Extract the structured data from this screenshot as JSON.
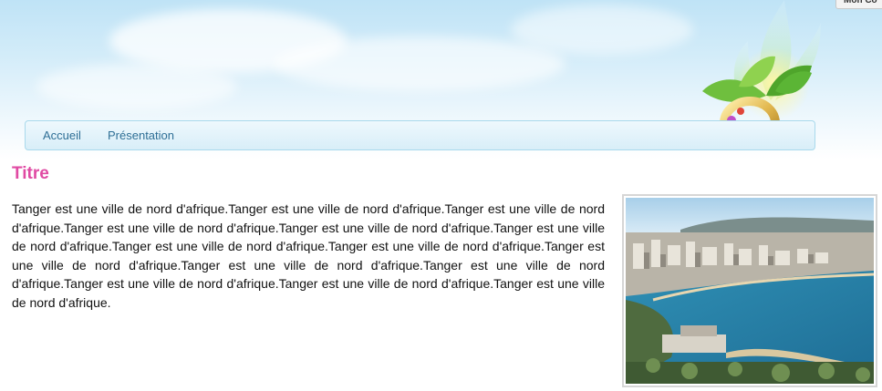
{
  "corner_button": {
    "label": "Mon Co"
  },
  "nav": {
    "items": [
      {
        "label": "Accueil"
      },
      {
        "label": "Présentation"
      }
    ]
  },
  "content": {
    "title": "Titre",
    "paragraph": "Tanger est une ville de nord d'afrique.Tanger est une ville de nord d'afrique.Tanger est une ville de nord d'afrique.Tanger est une ville de nord d'afrique.Tanger est une ville de nord d'afrique.Tanger est une ville de nord d'afrique.Tanger est une ville de nord d'afrique.Tanger est une ville de nord d'afrique.Tanger est une ville de nord d'afrique.Tanger est une ville de nord d'afrique.Tanger est une ville de nord d'afrique.Tanger est une ville de nord d'afrique.Tanger est une ville de nord d'afrique.Tanger est une ville de nord d'afrique."
  },
  "colors": {
    "title": "#e04aa3",
    "nav_text": "#2f6f96",
    "nav_border": "#a9d9ec"
  },
  "icons": {
    "logo": "ring-with-leaves-logo",
    "photo": "tangier-city-bay-photo"
  }
}
